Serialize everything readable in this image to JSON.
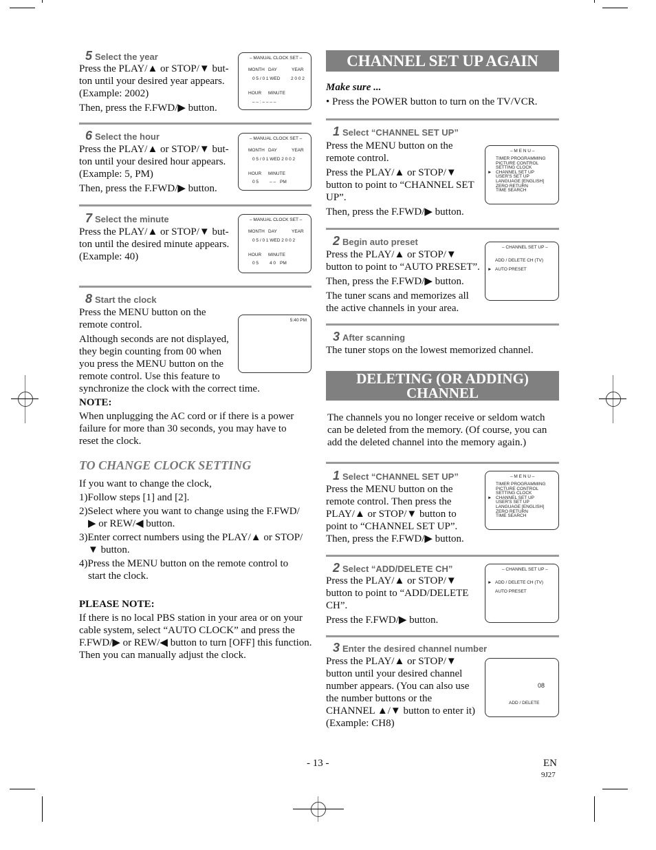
{
  "left": {
    "step5": {
      "num": "5",
      "title": "Select the year",
      "lines": [
        "Press the PLAY/▲ or STOP/▼ but-",
        "ton until your desired year appears.",
        "(Example: 2002)"
      ],
      "then": "Then, press the F.FWD/▶ button.",
      "screen": {
        "title": "– MANUAL CLOCK SET –",
        "month_label": "MONTH",
        "day_label": "DAY",
        "year_label": "YEAR",
        "date": "0 5  /  0 1   WED",
        "year": "2 0 0 2",
        "hour_label": "HOUR",
        "minute_label": "MINUTE",
        "time": "– –  :  – –   – –"
      }
    },
    "step6": {
      "num": "6",
      "title": "Select the hour",
      "lines": [
        "Press the PLAY/▲ or STOP/▼ but-",
        "ton until your desired hour appears.",
        "(Example: 5, PM)"
      ],
      "then": "Then, press the F.FWD/▶ button.",
      "screen": {
        "title": "– MANUAL CLOCK SET –",
        "month_label": "MONTH",
        "day_label": "DAY",
        "year_label": "YEAR",
        "date": "0 5  /  0 1   WED   2 0 0 2",
        "hour_label": "HOUR",
        "minute_label": "MINUTE",
        "hour": "0 5",
        "minute": "– –",
        "ampm": "PM"
      }
    },
    "step7": {
      "num": "7",
      "title": "Select the minute",
      "lines": [
        "Press the PLAY/▲ or STOP/▼ but-",
        "ton until the desired minute appears.",
        "(Example: 40)"
      ],
      "screen": {
        "title": "– MANUAL CLOCK SET –",
        "month_label": "MONTH",
        "day_label": "DAY",
        "year_label": "YEAR",
        "date": "0 5  /  0 1   WED   2 0 0 2",
        "hour_label": "HOUR",
        "minute_label": "MINUTE",
        "hour": "0 5",
        "minute": "4 0",
        "ampm": "PM"
      }
    },
    "step8": {
      "num": "8",
      "title": "Start the clock",
      "lines": [
        "Press the MENU button on the",
        "remote control.",
        "Although seconds are not displayed,",
        "they begin counting from 00 when",
        "you press the MENU button on the",
        "remote control. Use this feature to",
        "synchronize the clock with the correct time."
      ],
      "note_label": "NOTE:",
      "note_lines": [
        "When unplugging the AC cord or if there is a power",
        "failure for more than 30 seconds, you may have to",
        "reset the clock."
      ],
      "screen": {
        "time": "5:40 PM"
      }
    },
    "change_clock": {
      "title": "TO CHANGE CLOCK SETTING",
      "intro": "If you want to change the clock,",
      "items": [
        "1)Follow steps [1] and [2].",
        "2)Select where you want to change using the F.FWD/▶ or REW/◀ button.",
        "3)Enter correct numbers using the PLAY/▲ or STOP/▼ button.",
        "4)Press the MENU button on the remote control to start the clock."
      ]
    },
    "please_note": {
      "label": "PLEASE NOTE:",
      "text": "If there is no local PBS station in your area or on your cable system, select “AUTO CLOCK” and press the F.FWD/▶ or REW/◀ button to turn [OFF] this function. Then you can manually adjust the clock."
    }
  },
  "right": {
    "banner1": "CHANNEL SET UP AGAIN",
    "make_sure": "Make sure ...",
    "make_sure_bullet": "•  Press the POWER button to turn on the TV/VCR.",
    "a_step1": {
      "num": "1",
      "title": "Select “CHANNEL SET UP”",
      "text": "Press the MENU button on the remote control.",
      "text2": "Press the PLAY/▲ or STOP/▼ button to point to “CHANNEL SET UP”.",
      "then": "Then, press the F.FWD/▶ button."
    },
    "a_step2": {
      "num": "2",
      "title": "Begin auto preset",
      "text": "Press the PLAY/▲ or STOP/▼ button to point to “AUTO PRESET”.",
      "then": "Then, press the F.FWD/▶ button.",
      "text3": "The tuner scans and memorizes all the active channels in your area."
    },
    "a_step3": {
      "num": "3",
      "title": "After scanning",
      "text": "The tuner stops on the lowest memorized channel."
    },
    "banner2_line1": "DELETING (OR ADDING)",
    "banner2_line2": "CHANNEL",
    "intro": "The channels you no longer receive or seldom watch can be deleted from the memory. (Of course, you can add the deleted channel into the memory again.)",
    "b_step1": {
      "num": "1",
      "title": "Select “CHANNEL SET UP”",
      "text": "Press the MENU button on the remote control. Then press the PLAY/▲ or STOP/▼ button to point to “CHANNEL SET UP”.",
      "then": "Then, press the F.FWD/▶ button."
    },
    "b_step2": {
      "num": "2",
      "title": "Select “ADD/DELETE CH”",
      "text": "Press the PLAY/▲ or STOP/▼ button to point to “ADD/DELETE CH”.",
      "then": "Press the F.FWD/▶ button."
    },
    "b_step3": {
      "num": "3",
      "title": "Enter the desired channel number",
      "text": "Press the PLAY/▲ or STOP/▼ button until your desired channel number appears. (You can also use the number buttons  or the CHANNEL ▲/▼ button to enter it) (Example: CH8)"
    },
    "menu_screen": {
      "title": "– M E N U –",
      "items": [
        "TIMER PROGRAMMING",
        "PICTURE CONTROL",
        "SETTING CLOCK",
        "CHANNEL SET UP",
        "USER'S SET UP",
        "LANGUAGE  [ENGLISH]",
        "ZERO RETURN",
        "TIME SEARCH"
      ],
      "pointer": "►"
    },
    "chsetup_screen": {
      "title": "– CHANNEL SET UP –",
      "items": [
        "ADD / DELETE CH (TV)",
        "AUTO PRESET"
      ],
      "pointer": "►"
    },
    "adddelete_screen": {
      "channel": "08",
      "label": "ADD / DELETE"
    }
  },
  "footer": {
    "page": "- 13 -",
    "lang": "EN",
    "code": "9J27"
  }
}
